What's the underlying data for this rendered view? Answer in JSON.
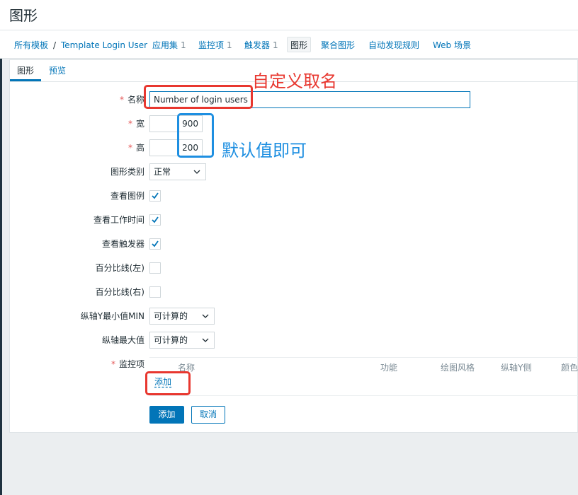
{
  "page": {
    "title": "图形"
  },
  "nav": {
    "items": [
      {
        "label": "所有模板"
      },
      {
        "label": "Template Login User"
      },
      {
        "label": "应用集",
        "count": "1"
      },
      {
        "label": "监控项",
        "count": "1"
      },
      {
        "label": "触发器",
        "count": "1"
      },
      {
        "label": "图形"
      },
      {
        "label": "聚合图形"
      },
      {
        "label": "自动发现规则"
      },
      {
        "label": "Web 场景"
      }
    ],
    "separator": "/"
  },
  "subtabs": {
    "graph": "图形",
    "preview": "预览"
  },
  "form": {
    "name": {
      "label": "名称",
      "value": "Number of login users"
    },
    "width": {
      "label": "宽",
      "value": "900"
    },
    "height": {
      "label": "高",
      "value": "200"
    },
    "graph_type": {
      "label": "图形类别",
      "value": "正常"
    },
    "show_legend": {
      "label": "查看图例",
      "checked": true
    },
    "show_work_period": {
      "label": "查看工作时间",
      "checked": true
    },
    "show_triggers": {
      "label": "查看触发器",
      "checked": true
    },
    "percentile_left": {
      "label": "百分比线(左)",
      "checked": false
    },
    "percentile_right": {
      "label": "百分比线(右)",
      "checked": false
    },
    "ymin": {
      "label": "纵轴Y最小值MIN",
      "value": "可计算的"
    },
    "ymax": {
      "label": "纵轴最大值",
      "value": "可计算的"
    },
    "items": {
      "label": "监控项",
      "columns": [
        "名称",
        "功能",
        "绘图风格",
        "纵轴Y侧",
        "颜色"
      ],
      "add_link": "添加"
    },
    "submit": "添加",
    "cancel": "取消",
    "required_mark": "*"
  },
  "annotations": {
    "name_note": "自定义取名",
    "size_note": "默认值即可",
    "red": "#e8372f",
    "blue": "#1e8fe1"
  },
  "colors": {
    "accent": "#0275b8",
    "required": "#e45959"
  }
}
